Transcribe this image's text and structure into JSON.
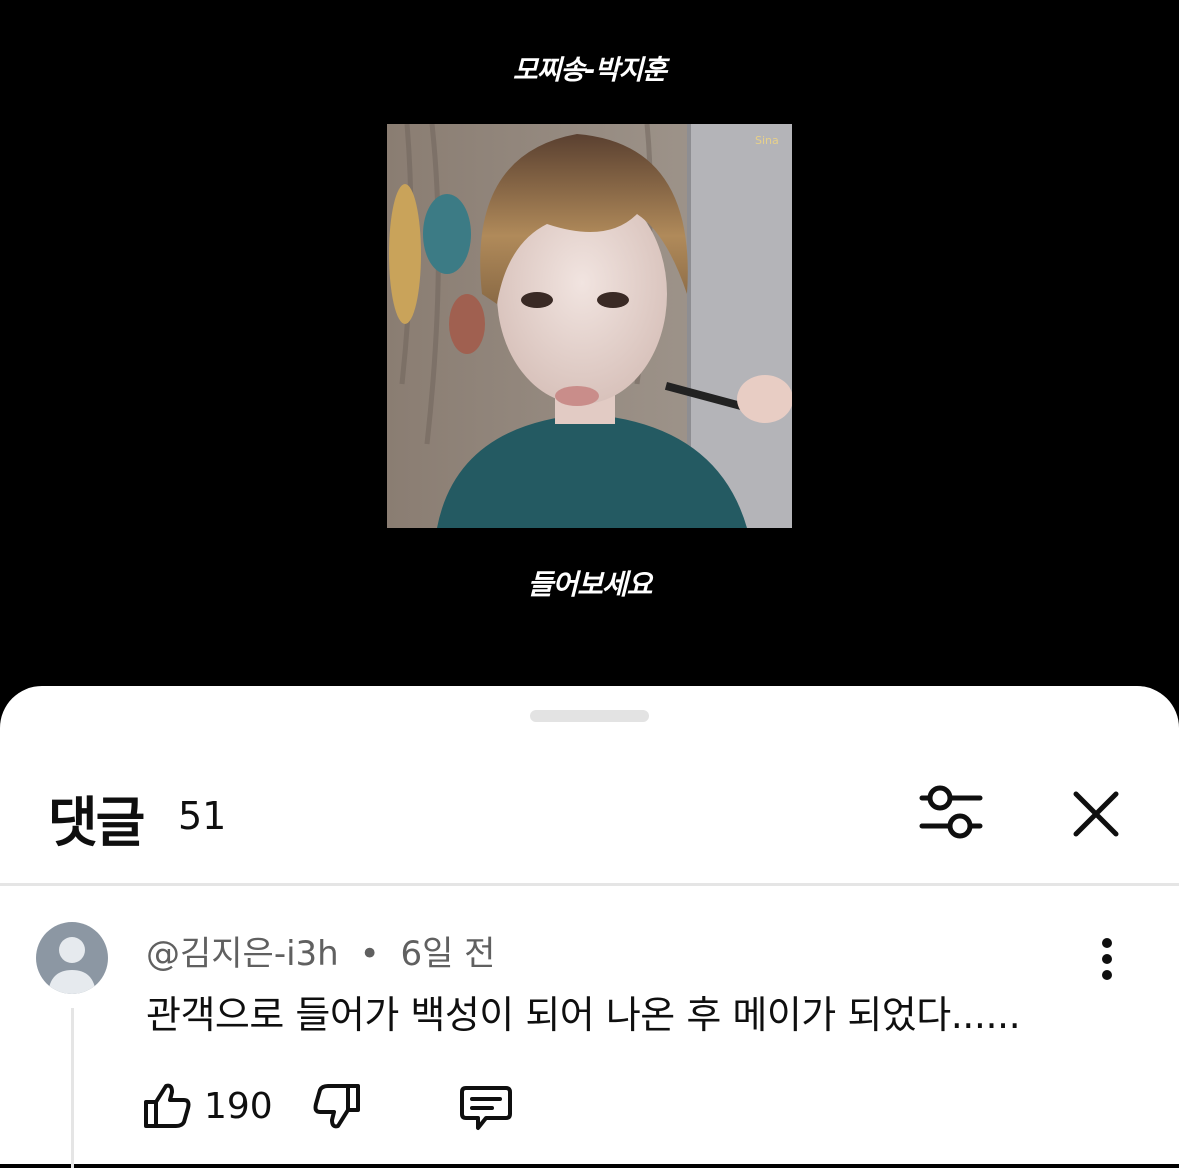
{
  "video": {
    "title": "모찌송-박지훈",
    "caption": "들어보세요",
    "watermark": "Sina"
  },
  "comments_sheet": {
    "title": "댓글",
    "count": "51",
    "icons": {
      "filter": "sliders-icon",
      "close": "close-icon"
    }
  },
  "comment": {
    "author": "@김지은-i3h",
    "separator": "•",
    "time": "6일 전",
    "text": "관객으로 들어가 백성이 되어 나온 후 메이가 되었다......",
    "likes": "190",
    "icons": {
      "like": "thumbs-up-icon",
      "dislike": "thumbs-down-icon",
      "reply": "reply-icon",
      "more": "more-vert-icon",
      "avatar": "default-avatar-icon"
    }
  },
  "colors": {
    "sheet_bg": "#ffffff",
    "text_primary": "#0f0f0f",
    "text_secondary": "#606060",
    "avatar_bg": "#8c97a3"
  }
}
